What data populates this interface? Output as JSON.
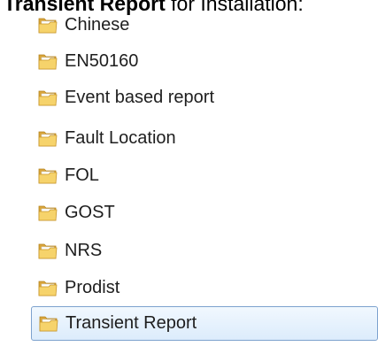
{
  "heading": {
    "bold_text": "Transient Report",
    "rest_text": " for Installation:"
  },
  "folders": [
    {
      "label": "Chinese",
      "icon": "folder-icon",
      "selected": false
    },
    {
      "label": "EN50160",
      "icon": "folder-icon",
      "selected": false
    },
    {
      "label": "Event based report",
      "icon": "folder-icon",
      "selected": false
    },
    {
      "label": "Fault Location",
      "icon": "folder-icon",
      "selected": false
    },
    {
      "label": "FOL",
      "icon": "folder-icon",
      "selected": false
    },
    {
      "label": "GOST",
      "icon": "folder-icon",
      "selected": false
    },
    {
      "label": "NRS",
      "icon": "folder-icon",
      "selected": false
    },
    {
      "label": "Prodist",
      "icon": "folder-icon",
      "selected": false
    },
    {
      "label": "Transient Report",
      "icon": "folder-icon",
      "selected": true
    }
  ],
  "colors": {
    "selection_border": "#7da2ce",
    "selection_fill_top": "#f1f8fe",
    "selection_fill_bottom": "#dcecfc",
    "folder_back": "#d9a53a",
    "folder_front": "#f6d36b",
    "folder_paper": "#ffffff"
  }
}
